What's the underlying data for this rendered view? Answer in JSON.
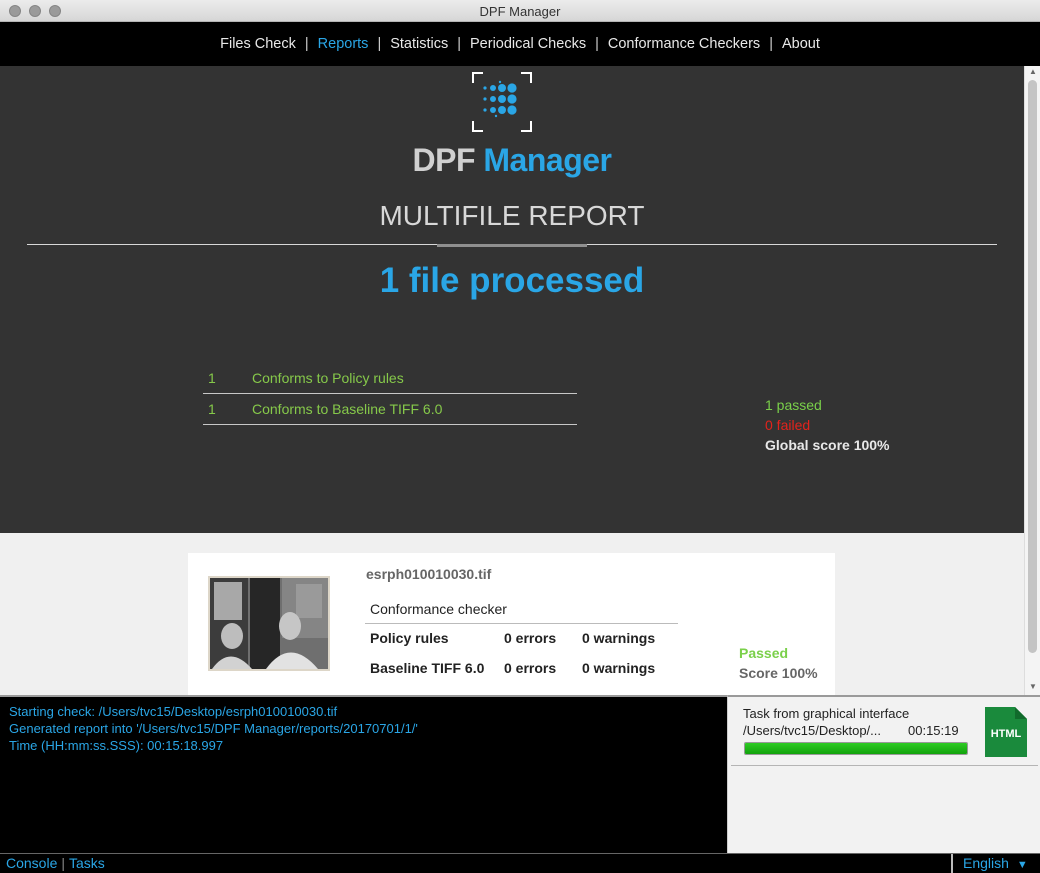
{
  "window": {
    "title": "DPF Manager"
  },
  "nav": {
    "items": [
      "Files Check",
      "Reports",
      "Statistics",
      "Periodical Checks",
      "Conformance Checkers",
      "About"
    ],
    "separator": "|",
    "active": "Reports"
  },
  "header": {
    "brand_part1": "DPF",
    "brand_part2": "Manager",
    "report_title": "MULTIFILE REPORT",
    "files_processed": "1 file processed"
  },
  "conformance": [
    {
      "count": "1",
      "label": "Conforms to Policy rules"
    },
    {
      "count": "1",
      "label": "Conforms to Baseline TIFF 6.0"
    }
  ],
  "summary": {
    "passed": "1 passed",
    "failed": "0 failed",
    "global_score": "Global score 100%"
  },
  "file_card": {
    "file_name": "esrph010010030.tif",
    "checker_header": "Conformance checker",
    "rows": [
      {
        "name": "Policy rules",
        "errors": "0 errors",
        "warnings": "0 warnings"
      },
      {
        "name": "Baseline TIFF 6.0",
        "errors": "0 errors",
        "warnings": "0 warnings"
      }
    ],
    "status": "Passed",
    "score": "Score 100%"
  },
  "console": {
    "lines": [
      "Starting check: /Users/tvc15/Desktop/esrph010010030.tif",
      "Generated report into '/Users/tvc15/DPF Manager/reports/20170701/1/'",
      "Time (HH:mm:ss.SSS): 00:15:18.997"
    ]
  },
  "task": {
    "title": "Task from graphical interface",
    "path": "/Users/tvc15/Desktop/...",
    "time": "00:15:19",
    "progress": 1.0,
    "icon_label": "HTML"
  },
  "statusbar": {
    "console_label": "Console",
    "separator": "|",
    "tasks_label": "Tasks",
    "language": "English"
  },
  "colors": {
    "accent": "#2aa6e6",
    "pass": "#7ad04a",
    "fail": "#e3231c",
    "progress": "#1fb518",
    "html_icon": "#1a8a3c"
  }
}
